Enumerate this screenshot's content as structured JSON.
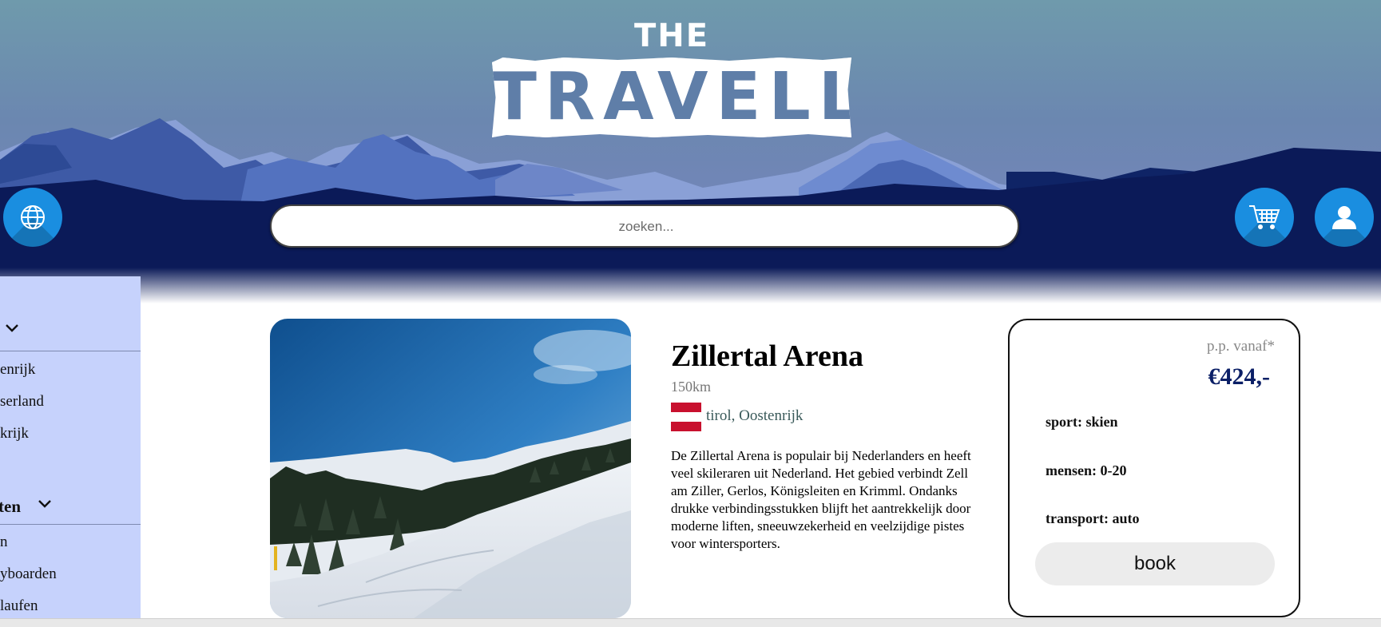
{
  "header": {
    "logo_top": "THE",
    "logo_main": "TRAVELLER",
    "search_placeholder": "zoeken...",
    "language_button": "globe-icon",
    "cart_button": "cart-icon",
    "account_button": "user-icon"
  },
  "sidebar": {
    "groups": [
      {
        "label": "",
        "items": [
          "enrijk",
          "serland",
          "krijk"
        ]
      },
      {
        "label": "ten",
        "items": [
          "n",
          "yboarden",
          "laufen"
        ]
      }
    ]
  },
  "destination": {
    "title": "Zillertal Arena",
    "distance": "150km",
    "region": "tirol, Oostenrijk",
    "flag_colors": [
      "#c8102e",
      "#ffffff",
      "#c8102e"
    ],
    "description": "De Zillertal Arena is populair bij Nederlanders en heeft veel skileraren uit Nederland. Het gebied verbindt Zell am Ziller, Gerlos, Königsleiten en Krimml. Ondanks drukke verbindingsstukken blijft het aantrekkelijk door moderne liften, sneeuwzekerheid en veelzijdige pistes voor wintersporters."
  },
  "booking": {
    "from_label": "p.p. vanaf*",
    "price": "€424,-",
    "sport": "sport: skien",
    "people": "mensen: 0-20",
    "transport": "transport: auto",
    "book_label": "book"
  },
  "colors": {
    "accent": "#1a8ee0",
    "header_dark": "#0b1a58",
    "sidebar_bg": "#c6d2fc",
    "price": "#0b1f66"
  }
}
